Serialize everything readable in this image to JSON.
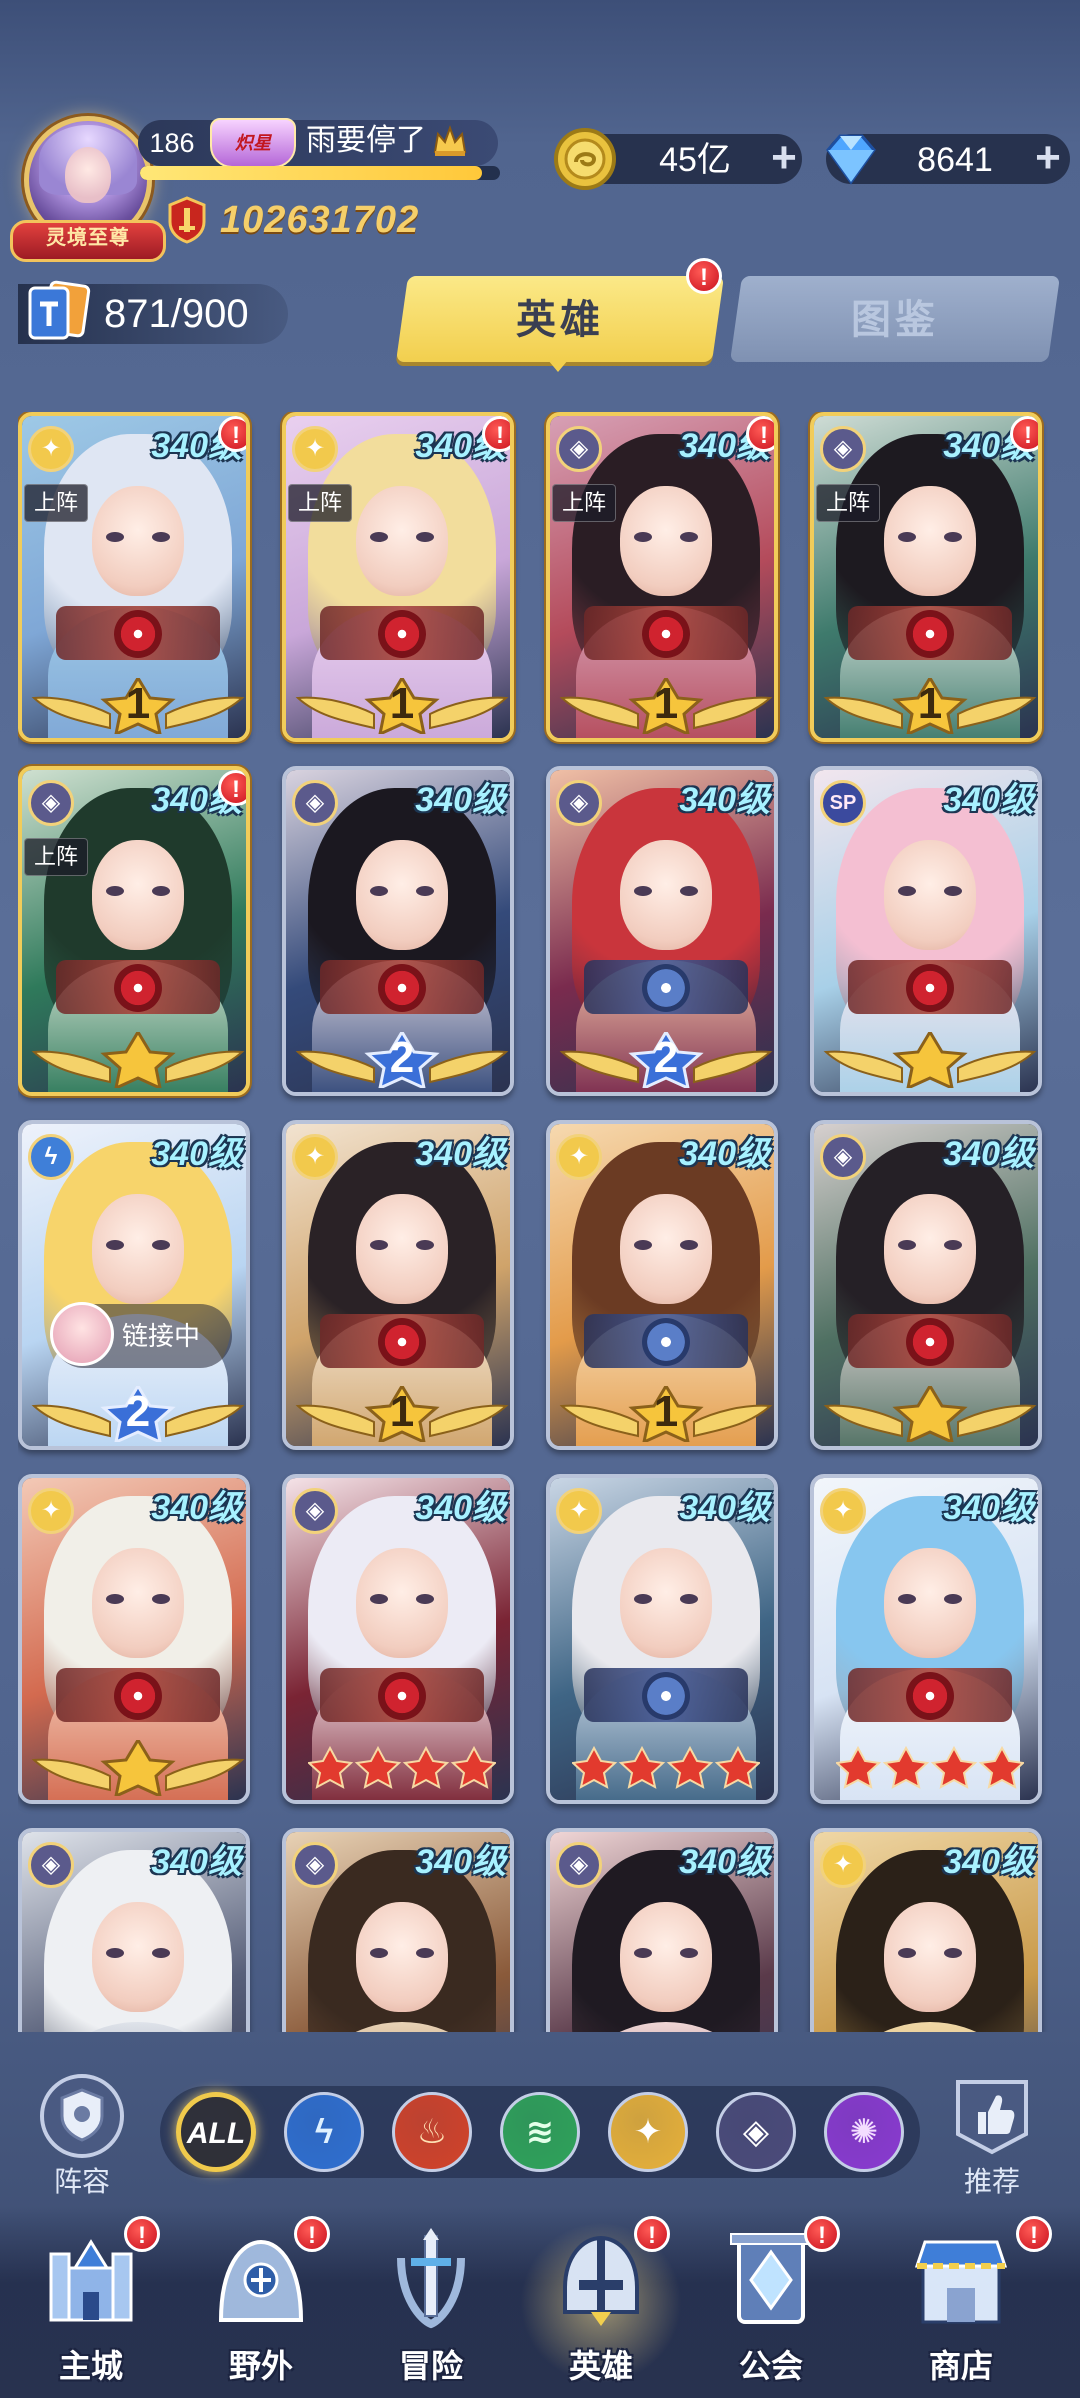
{
  "player": {
    "level": "186",
    "vip_badge": "炽星",
    "name": "雨要停了",
    "title": "灵境至尊",
    "exp_progress": 0.95,
    "power": "102631702"
  },
  "resources": {
    "gold": "45亿",
    "gems": "8641",
    "plus": "+"
  },
  "collection": {
    "count": "871/900"
  },
  "tabs": {
    "hero": "英雄",
    "atlas": "图鉴",
    "hero_badge": "!"
  },
  "heroes": [
    {
      "level": "340级",
      "element": "light",
      "deployed": "上阵",
      "stars": "1",
      "star_style": "gold-wings",
      "badge": "!"
    },
    {
      "level": "340级",
      "element": "light",
      "deployed": "上阵",
      "stars": "1",
      "star_style": "gold-wings",
      "badge": "!"
    },
    {
      "level": "340级",
      "element": "dark",
      "deployed": "上阵",
      "stars": "1",
      "star_style": "gold-wings",
      "badge": "!"
    },
    {
      "level": "340级",
      "element": "dark",
      "deployed": "上阵",
      "stars": "1",
      "star_style": "gold-wings",
      "badge": "!"
    },
    {
      "level": "340级",
      "element": "dark",
      "deployed": "上阵",
      "stars": "★",
      "star_style": "gold-wings",
      "badge": "!"
    },
    {
      "level": "340级",
      "element": "dark",
      "deployed": "",
      "stars": "2",
      "star_style": "blue-wings",
      "badge": ""
    },
    {
      "level": "340级",
      "element": "dark",
      "deployed": "",
      "stars": "2",
      "star_style": "blue-wings",
      "badge": ""
    },
    {
      "level": "340级",
      "element": "sp",
      "deployed": "",
      "stars": "★",
      "star_style": "gold-wings",
      "badge": ""
    },
    {
      "level": "340级",
      "element": "water",
      "deployed": "",
      "stars": "2",
      "star_style": "blue-wings",
      "badge": "",
      "linking": "链接中"
    },
    {
      "level": "340级",
      "element": "light",
      "deployed": "",
      "stars": "1",
      "star_style": "gold-wings",
      "badge": ""
    },
    {
      "level": "340级",
      "element": "light",
      "deployed": "",
      "stars": "1",
      "star_style": "gold-wings",
      "badge": ""
    },
    {
      "level": "340级",
      "element": "dark",
      "deployed": "",
      "stars": "★",
      "star_style": "gold-wings",
      "badge": ""
    },
    {
      "level": "340级",
      "element": "light",
      "deployed": "",
      "stars": "★",
      "star_style": "gold-wings",
      "badge": ""
    },
    {
      "level": "340级",
      "element": "dark",
      "deployed": "",
      "stars": "4",
      "star_style": "red-stars",
      "badge": ""
    },
    {
      "level": "340级",
      "element": "light",
      "deployed": "",
      "stars": "4",
      "star_style": "red-stars",
      "badge": ""
    },
    {
      "level": "340级",
      "element": "light",
      "deployed": "",
      "stars": "4",
      "star_style": "red-stars",
      "badge": ""
    },
    {
      "level": "340级",
      "element": "dark",
      "deployed": "",
      "stars": "",
      "star_style": "none",
      "badge": ""
    },
    {
      "level": "340级",
      "element": "dark",
      "deployed": "",
      "stars": "",
      "star_style": "none",
      "badge": ""
    },
    {
      "level": "340级",
      "element": "dark",
      "deployed": "",
      "stars": "",
      "star_style": "none",
      "badge": ""
    },
    {
      "level": "340级",
      "element": "light",
      "deployed": "",
      "stars": "",
      "star_style": "none",
      "badge": ""
    }
  ],
  "filters": {
    "lineup": "阵容",
    "recommend": "推荐",
    "all": "ALL",
    "factions": [
      "all",
      "water",
      "fire",
      "wind",
      "light",
      "dark",
      "void"
    ],
    "selected": "all"
  },
  "nav": [
    {
      "label": "主城",
      "icon": "castle-icon",
      "badge": "!",
      "active": false
    },
    {
      "label": "野外",
      "icon": "wilds-icon",
      "badge": "!",
      "active": false
    },
    {
      "label": "冒险",
      "icon": "adventure-icon",
      "badge": "",
      "active": false
    },
    {
      "label": "英雄",
      "icon": "hero-helmet-icon",
      "badge": "!",
      "active": true
    },
    {
      "label": "公会",
      "icon": "guild-icon",
      "badge": "!",
      "active": false
    },
    {
      "label": "商店",
      "icon": "shop-icon",
      "badge": "!",
      "active": false
    }
  ],
  "colors": {
    "accent_gold": "#f2cf4e",
    "level_text": "#a7f1ff",
    "badge_red": "#c9111e"
  }
}
